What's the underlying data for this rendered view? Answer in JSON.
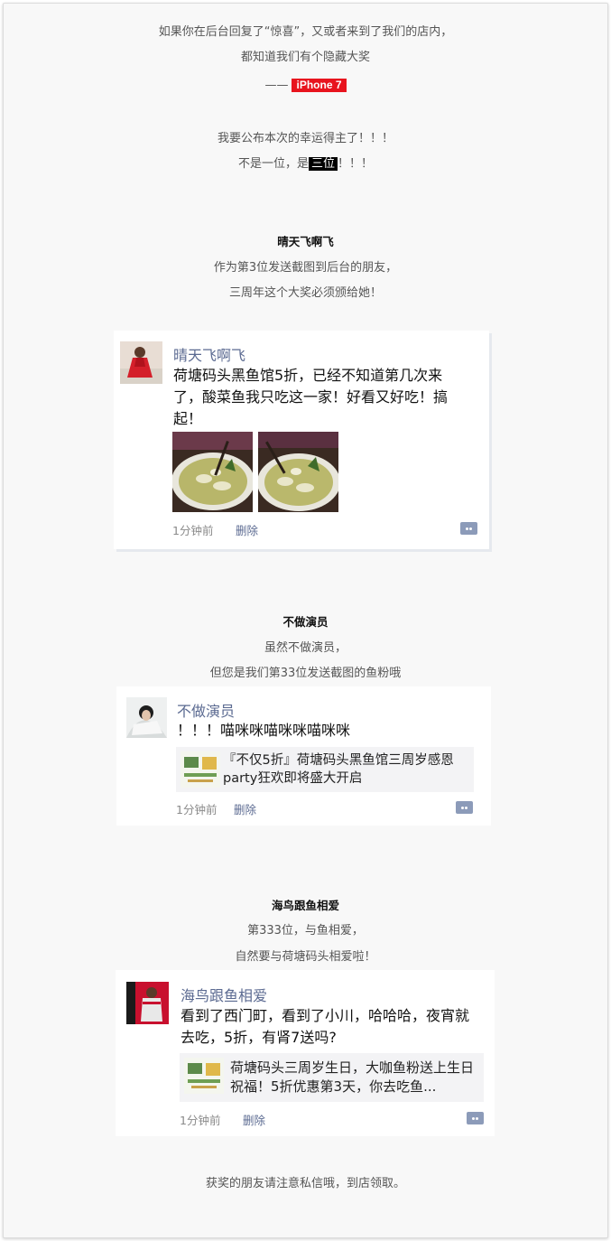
{
  "intro": {
    "line1": "如果你在后台回复了“惊喜”，又或者来到了我们的店内，",
    "line2": "都知道我们有个隐藏大奖",
    "dash": "——",
    "prize": "iPhone 7",
    "announce": "我要公布本次的幸运得主了！！！",
    "count_pre": "不是一位，是",
    "count_hl": "三位",
    "count_post": "！！！"
  },
  "winners": [
    {
      "heading": "晴天飞啊飞",
      "desc1": "作为第3位发送截图到后台的朋友，",
      "desc2": "三周年这个大奖必须颁给她！",
      "card": {
        "name": "晴天飞啊飞",
        "text": "荷塘码头黑鱼馆5折，已经不知道第几次来了，酸菜鱼我只吃这一家！好看又好吃！搞起！",
        "time": "1分钟前",
        "delete": "删除"
      }
    },
    {
      "heading": "不做演员",
      "desc1": "虽然不做演员，",
      "desc2": "但您是我们第33位发送截图的鱼粉哦",
      "card": {
        "name": "不做演员",
        "text": "！！！喵咪咪喵咪咪喵咪咪",
        "link": "『不仅5折』荷塘码头黑鱼馆三周岁感恩party狂欢即将盛大开启",
        "time": "1分钟前",
        "delete": "删除"
      }
    },
    {
      "heading": "海鸟跟鱼相爱",
      "desc1": "第333位，与鱼相爱，",
      "desc2": "自然要与荷塘码头相爱啦！",
      "card": {
        "name": "海鸟跟鱼相爱",
        "text": "看到了西门町，看到了小川，哈哈哈，夜宵就去吃，5折，有肾7送吗?",
        "link": "荷塘码头三周岁生日，大咖鱼粉送上生日祝福！5折优惠第3天，你去吃鱼...",
        "time": "1分钟前",
        "delete": "删除"
      }
    }
  ],
  "footer": "获奖的朋友请注意私信哦，到店领取。",
  "colors": {
    "accent_red": "#e8141e",
    "name_blue": "#5b6a91"
  }
}
